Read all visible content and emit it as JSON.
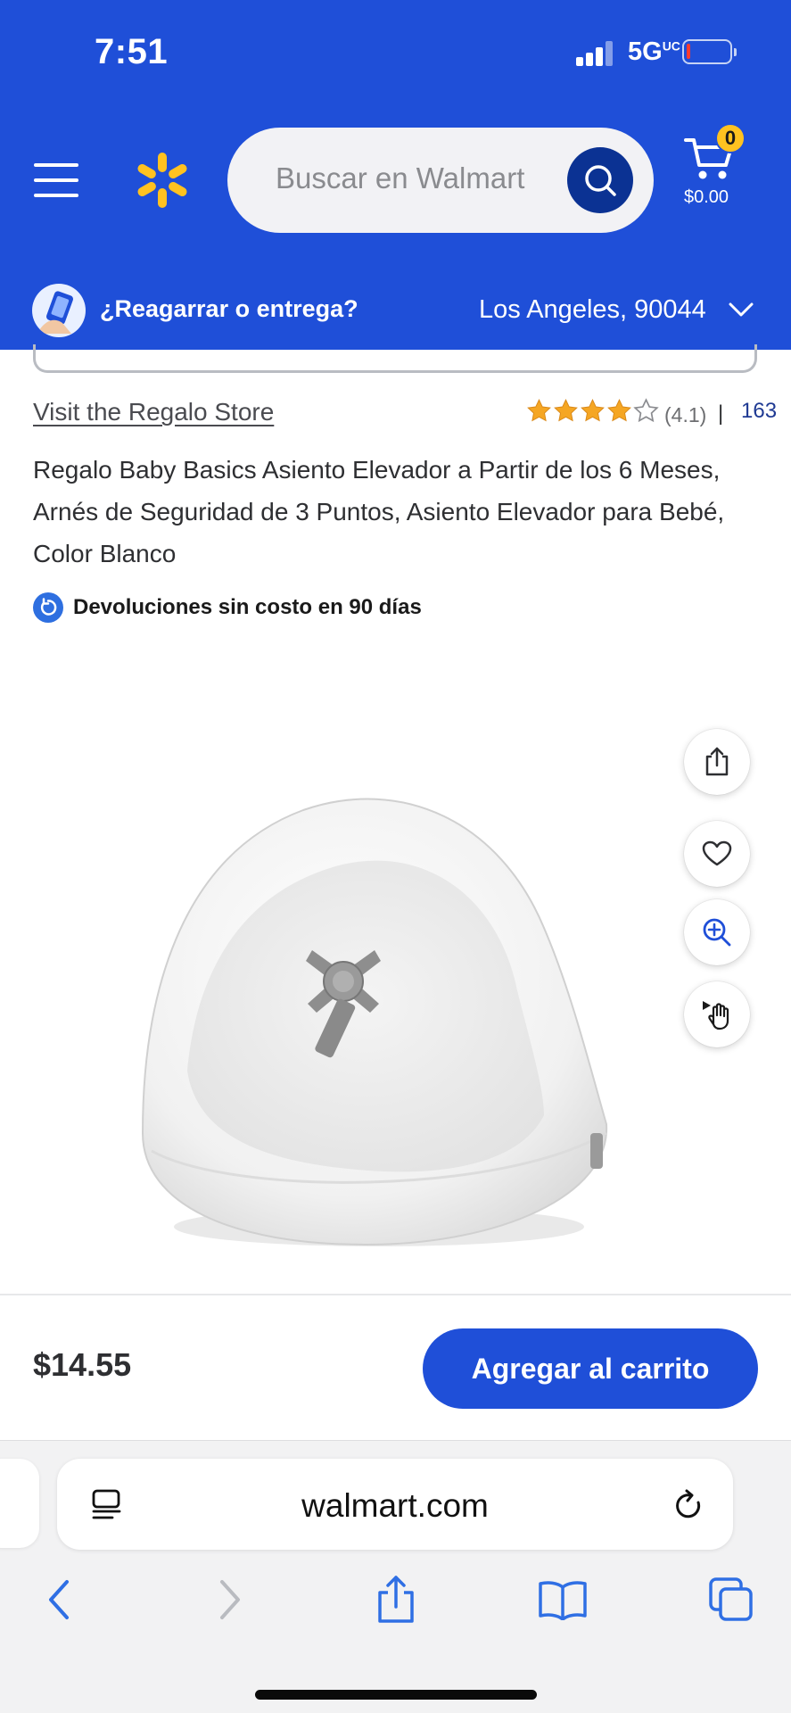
{
  "status_bar": {
    "time": "7:51",
    "network": "5G",
    "network_suffix": "UC"
  },
  "header": {
    "search_placeholder": "Buscar en Walmart",
    "cart_count": "0",
    "cart_total": "$0.00",
    "delivery_prompt": "¿Reagarrar o entrega?",
    "location": "Los Angeles, 90044"
  },
  "product": {
    "store_link": "Visit the Regalo Store",
    "rating_value": 4.1,
    "rating_text": "(4.1)",
    "rating_separator": "|",
    "review_count": "163",
    "title": "Regalo Baby Basics Asiento Elevador a Partir de los 6 Meses, Arnés de Seguridad de 3 Puntos, Asiento Elevador para Bebé, Color Blanco",
    "returns": "Devoluciones sin costo en 90 días",
    "price": "$14.55",
    "add_to_cart": "Agregar al carrito"
  },
  "image_actions": [
    "share-icon",
    "heart-icon",
    "zoom-in-icon",
    "view-in-room-icon"
  ],
  "browser": {
    "url": "walmart.com"
  },
  "colors": {
    "brand_blue": "#1f4fd8",
    "spark_yellow": "#ffc220",
    "dark_blue": "#0b3293"
  }
}
